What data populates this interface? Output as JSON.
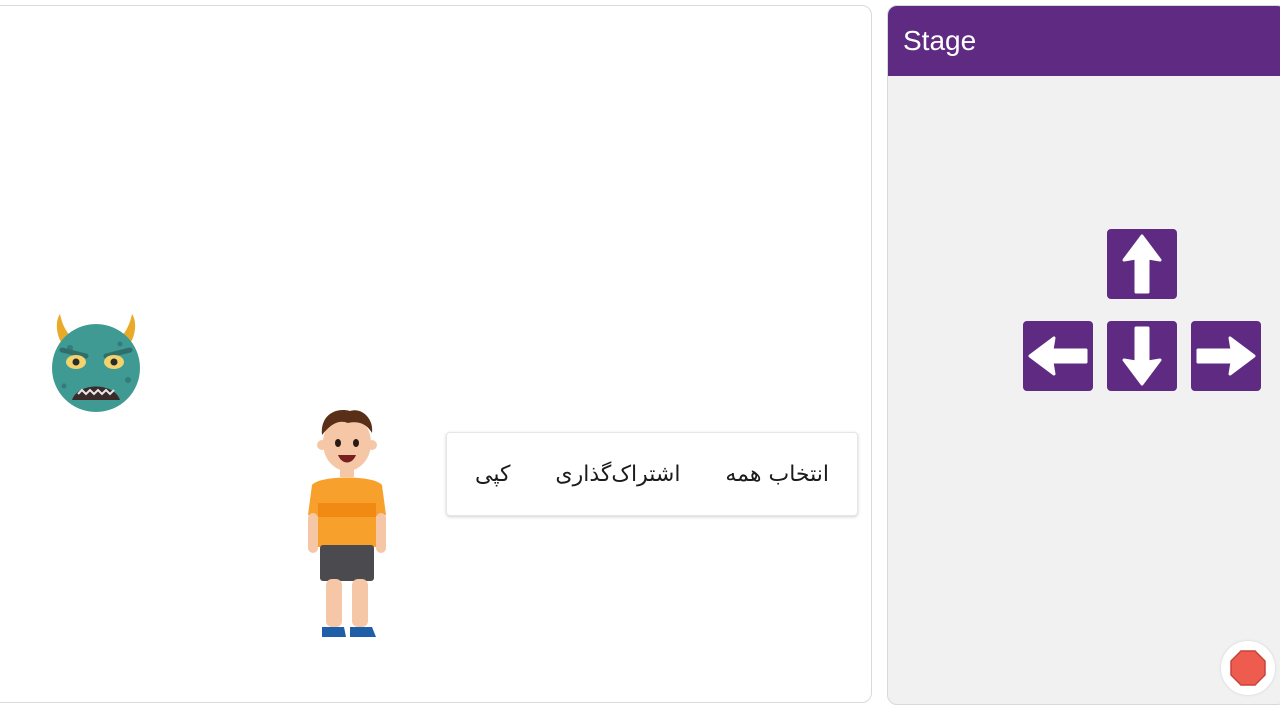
{
  "canvas": {
    "sprites": [
      {
        "name": "monster-sprite",
        "icon": "green-horned-monster-face"
      },
      {
        "name": "boy-sprite",
        "icon": "boy-in-orange-shirt"
      }
    ],
    "context_menu": {
      "items": [
        {
          "label": "کپی"
        },
        {
          "label": "اشتراک‌گذاری"
        },
        {
          "label": "انتخاب همه"
        }
      ]
    }
  },
  "stage": {
    "title": "Stage",
    "accent_color": "#5f2b82",
    "background_color": "#f1f1f1",
    "controls": {
      "up": "arrow-up-icon",
      "left": "arrow-left-icon",
      "down": "arrow-down-icon",
      "right": "arrow-right-icon"
    },
    "stop_button": {
      "icon": "stop-octagon-icon",
      "color": "#ee5b4f"
    }
  }
}
